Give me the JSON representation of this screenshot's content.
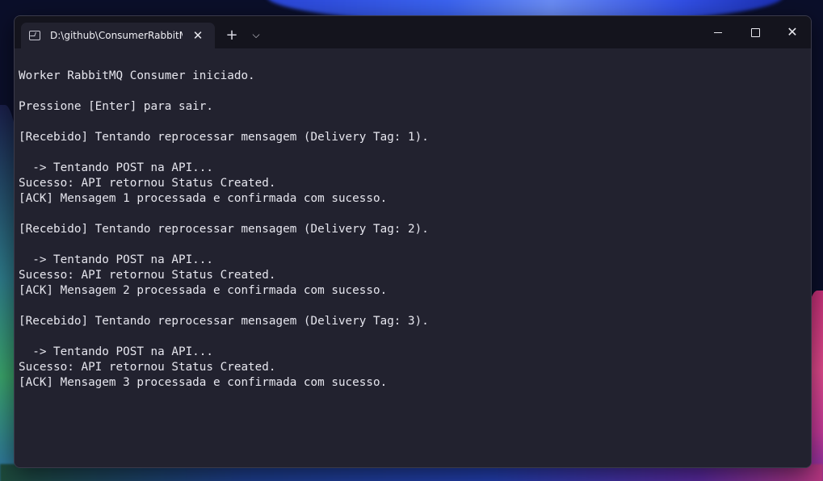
{
  "window": {
    "tab_title": "D:\\github\\ConsumerRabbitMQ",
    "new_tab": "+",
    "tab_dropdown": "⌵",
    "close_tab": "✕",
    "close_window": "✕"
  },
  "console": {
    "lines": [
      "Worker RabbitMQ Consumer iniciado.",
      "",
      "Pressione [Enter] para sair.",
      "",
      "[Recebido] Tentando reprocessar mensagem (Delivery Tag: 1).",
      "",
      "  -> Tentando POST na API...",
      "Sucesso: API retornou Status Created.",
      "[ACK] Mensagem 1 processada e confirmada com sucesso.",
      "",
      "[Recebido] Tentando reprocessar mensagem (Delivery Tag: 2).",
      "",
      "  -> Tentando POST na API...",
      "Sucesso: API retornou Status Created.",
      "[ACK] Mensagem 2 processada e confirmada com sucesso.",
      "",
      "[Recebido] Tentando reprocessar mensagem (Delivery Tag: 3).",
      "",
      "  -> Tentando POST na API...",
      "Sucesso: API retornou Status Created.",
      "[ACK] Mensagem 3 processada e confirmada com sucesso."
    ]
  }
}
